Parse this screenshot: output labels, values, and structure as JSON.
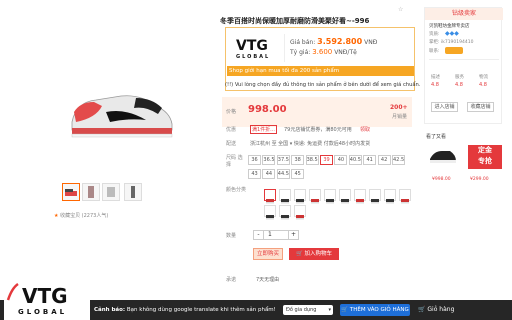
{
  "product": {
    "title": "冬季百搭时尚保暖加厚耐磨防滑美聚好看~-996",
    "fav_text": "收藏宝贝 (2273人气)"
  },
  "vtg": {
    "logo_top": "VTG",
    "logo_bottom": "GLOBAL",
    "price_label": "Giá bán:",
    "price_value": "3.592.800",
    "price_unit": "VNĐ",
    "rate_label": "Tỷ giá:",
    "rate_value": "3.600",
    "rate_unit": "VNĐ/Tệ",
    "limit_text": "Shop giới hạn mua tối đa 200 sản phẩm",
    "notice": "(!!) Vui lòng chọn đầy đủ thông tin sản phẩm ở bên dưới để xem giá chuẩn."
  },
  "price": {
    "label": "价格",
    "value": "998.00",
    "sold": "200+",
    "sold_label": "月销量",
    "promo_label": "优惠",
    "promo_badge": "满1件折...",
    "promo_text": "79元店铺优惠券，满80元可用",
    "promo_link": "领取",
    "ship_label": "配送",
    "ship_text": "浙江杭州 至 全国 ▾ 快递: 免运费 付款后48小时内发货"
  },
  "sizes": {
    "label": "尺码 选择",
    "items": [
      "36",
      "36.5",
      "37.5",
      "38",
      "38.5",
      "39",
      "40",
      "40.5",
      "41",
      "42",
      "42.5",
      "43",
      "44",
      "44.5",
      "45"
    ],
    "selected": "39"
  },
  "colors": {
    "label": "颜色分类",
    "count": 13
  },
  "quantity": {
    "label": "数量",
    "value": "1",
    "minus": "-",
    "plus": "+"
  },
  "actions": {
    "buy_now": "立即购买",
    "add_cart": "加入购物车",
    "service_label": "承诺",
    "service_text": "7天无理由"
  },
  "right_panel": {
    "header": "钻级卖家",
    "shop_name": "贝凯鞋坊金牌专卖店",
    "qualification": "资质:",
    "merchant_label": "掌柜:",
    "merchant_value": "ik7190194410",
    "contact_label": "联系:",
    "score_desc": "描述",
    "score_service": "服务",
    "score_logistics": "物流",
    "score_desc_val": "4.8",
    "score_service_val": "4.8",
    "score_logistics_val": "4.8",
    "enter_shop": "进入店铺",
    "fav_shop": "收藏店铺",
    "shop_hot": "看了又看"
  },
  "promo": {
    "title": "看了又看",
    "badge1": "定金",
    "badge2": "专抢",
    "price1": "¥998.00",
    "price2": "¥299.00"
  },
  "bottom_bar": {
    "warning_bold": "Cảnh báo:",
    "warning_text": "Bạn không dùng google translate khi thêm sản phẩm!",
    "select_value": "Đồ gia dụng",
    "add_button": "THÊM VÀO GIỎ HÀNG",
    "cart_button": "Giỏ hàng",
    "logo_top": "VTG",
    "logo_bottom": "GLOBAL"
  },
  "colors_theme": {
    "accent_red": "#e4393c",
    "accent_orange": "#f6a623",
    "accent_blue": "#1e6fd9"
  }
}
